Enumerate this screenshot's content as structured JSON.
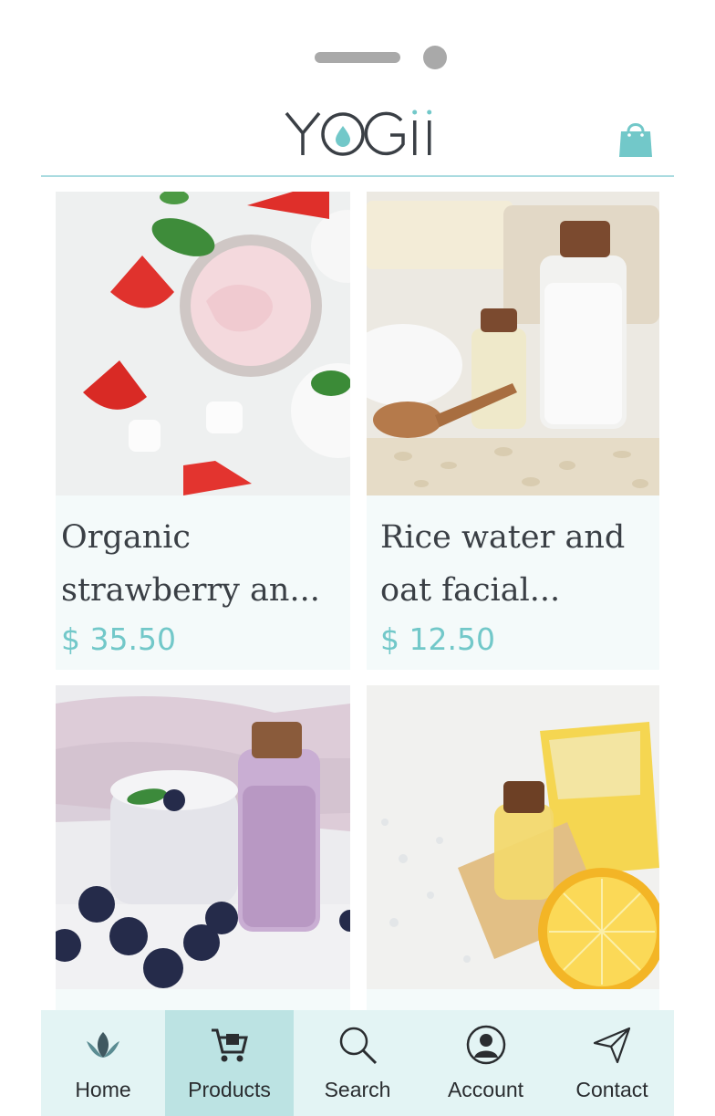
{
  "brand": {
    "logo_text": "YOGII",
    "accent": "#72c8c9"
  },
  "header": {
    "cart_icon": "shopping-bag-icon"
  },
  "products": [
    {
      "name": "Organic strawberry an...",
      "price": "$ 35.50",
      "image": "strawberry-cream-photo"
    },
    {
      "name": "Rice water and oat facial...",
      "price": "$ 12.50",
      "image": "rice-water-oat-photo"
    },
    {
      "name": "",
      "price": "",
      "image": "blueberry-cream-photo"
    },
    {
      "name": "",
      "price": "",
      "image": "lemon-soap-oil-photo"
    }
  ],
  "tabbar": {
    "active": "Products",
    "tabs": [
      {
        "label": "Home",
        "icon": "lotus-icon"
      },
      {
        "label": "Products",
        "icon": "cart-icon"
      },
      {
        "label": "Search",
        "icon": "search-icon"
      },
      {
        "label": "Account",
        "icon": "user-icon"
      },
      {
        "label": "Contact",
        "icon": "send-icon"
      }
    ]
  }
}
